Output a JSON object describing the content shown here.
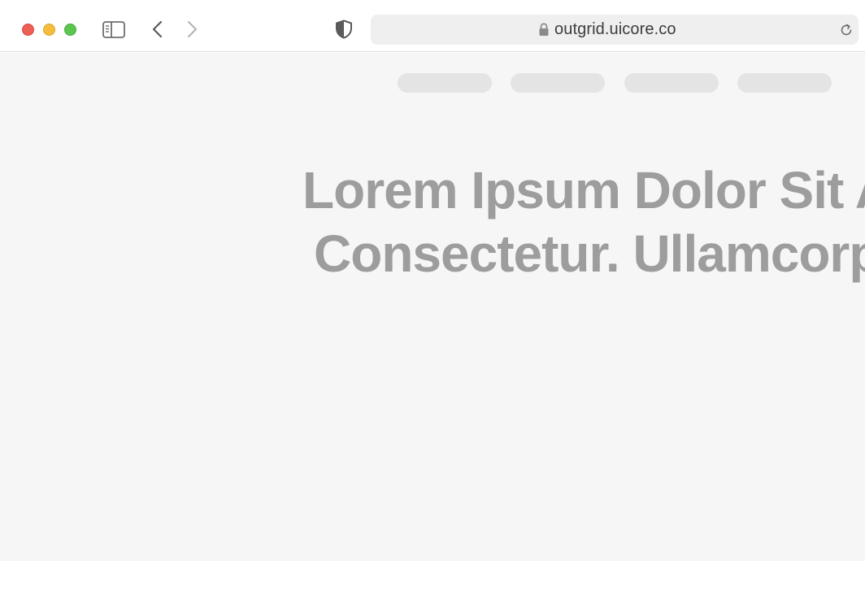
{
  "browser": {
    "url": "outgrid.uicore.co",
    "icons": {
      "close": "close-window-icon",
      "minimize": "minimize-window-icon",
      "maximize": "maximize-window-icon",
      "sidebar": "sidebar-toggle-icon",
      "back": "chevron-left-icon",
      "forward": "chevron-right-icon",
      "privacy": "shield-icon",
      "secure": "lock-icon",
      "reload": "reload-icon"
    },
    "colors": {
      "close": "#ee5f56",
      "minimize": "#f4bd3b",
      "maximize": "#5ac54f"
    }
  },
  "page": {
    "nav_placeholders": 4,
    "headline": {
      "line1": "Lorem Ipsum Dolor Sit Am",
      "line2": "Consectetur. Ullamcorpe"
    },
    "colors": {
      "background": "#f6f6f6",
      "headline": "#9d9d9d",
      "placeholder": "#e4e4e4"
    }
  }
}
